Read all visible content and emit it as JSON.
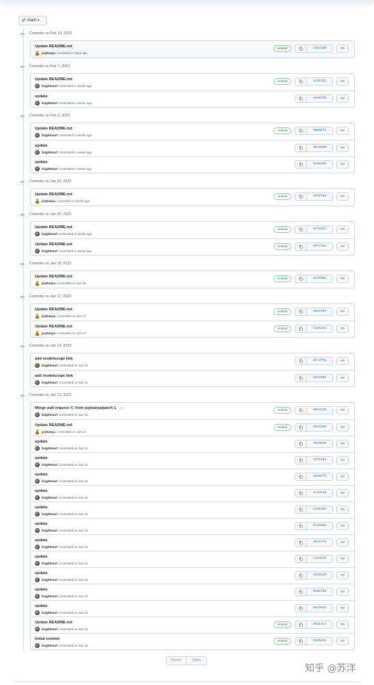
{
  "branch": {
    "label": "main",
    "icon": "git-branch-icon"
  },
  "groups": [
    {
      "date": "Commits on Feb 14, 2023",
      "commits": [
        {
          "message": "Update README.md",
          "author": "joytianya",
          "time": "committed 4 days ago",
          "verified": true,
          "sha": "c51c320"
        }
      ]
    },
    {
      "date": "Commits on Feb 7, 2023",
      "commits": [
        {
          "message": "Update README.md",
          "author": "brightmart",
          "time": "committed 2 weeks ago",
          "verified": true,
          "sha": "3c4572c"
        },
        {
          "message": "update",
          "author": "brightmart",
          "time": "committed 2 weeks ago",
          "verified": false,
          "sha": "8ee6f36"
        }
      ]
    },
    {
      "date": "Commits on Feb 3, 2023",
      "commits": [
        {
          "message": "Update README.md",
          "author": "brightmart",
          "time": "committed 2 weeks ago",
          "verified": true,
          "sha": "2906bf3"
        },
        {
          "message": "update",
          "author": "brightmart",
          "time": "committed 2 weeks ago",
          "verified": false,
          "sha": "d5c8450"
        },
        {
          "message": "update",
          "author": "brightmart",
          "time": "committed 2 weeks ago",
          "verified": false,
          "sha": "91583b0"
        }
      ]
    },
    {
      "date": "Commits on Jan 30, 2023",
      "commits": [
        {
          "message": "Update README.md",
          "author": "joytianya",
          "time": "committed 3 weeks ago",
          "verified": true,
          "sha": "4f0ff69"
        }
      ]
    },
    {
      "date": "Commits on Jan 20, 2023",
      "commits": [
        {
          "message": "Update README.md",
          "author": "brightmart",
          "time": "committed 3 weeks ago",
          "verified": true,
          "sha": "97f41f2"
        },
        {
          "message": "Update README.md",
          "author": "brightmart",
          "time": "committed 3 weeks ago",
          "verified": true,
          "sha": "b07c1a4"
        }
      ]
    },
    {
      "date": "Commits on Jan 18, 2023",
      "commits": [
        {
          "message": "Update README.md",
          "author": "joytianya",
          "time": "committed on Jan 18",
          "verified": true,
          "sha": "9c5f0ba"
        }
      ]
    },
    {
      "date": "Commits on Jan 17, 2023",
      "commits": [
        {
          "message": "Update README.md",
          "author": "joytianya",
          "time": "committed on Jan 17",
          "verified": true,
          "sha": "aaee43e"
        },
        {
          "message": "Update README.md",
          "author": "joytianya",
          "time": "committed on Jan 17",
          "verified": true,
          "sha": "b426244"
        }
      ]
    },
    {
      "date": "Commits on Jan 14, 2023",
      "commits": [
        {
          "message": "add modelscope link",
          "author": "brightmart",
          "time": "committed on Jan 14",
          "verified": false,
          "sha": "2fc7f71"
        },
        {
          "message": "add modelscope link",
          "author": "brightmart",
          "time": "committed on Jan 14",
          "verified": false,
          "sha": "5337588"
        }
      ]
    },
    {
      "date": "Commits on Jan 13, 2023",
      "commits": [
        {
          "message": "Merge pull request ",
          "link": "#1",
          "suffix": " from joytianya/patch-1",
          "author": "brightmart",
          "time": "committed on Jan 13",
          "verified": true,
          "sha": "40e3c18",
          "dots": true
        },
        {
          "message": "Update README.md",
          "author": "joytianya",
          "time": "committed on Jan 13",
          "verified": true,
          "sha": "8594260"
        },
        {
          "message": "update",
          "author": "brightmart",
          "time": "committed on Jan 13",
          "verified": false,
          "sha": "4033643"
        },
        {
          "message": "update",
          "author": "brightmart",
          "time": "committed on Jan 13",
          "verified": false,
          "sha": "2747404"
        },
        {
          "message": "update",
          "author": "brightmart",
          "time": "committed on Jan 13",
          "verified": false,
          "sha": "e630ef3"
        },
        {
          "message": "update",
          "author": "brightmart",
          "time": "committed on Jan 13",
          "verified": false,
          "sha": "1c3dca8"
        },
        {
          "message": "update",
          "author": "brightmart",
          "time": "committed on Jan 13",
          "verified": false,
          "sha": "c535380"
        },
        {
          "message": "update",
          "author": "brightmart",
          "time": "committed on Jan 13",
          "verified": false,
          "sha": "97d4686"
        },
        {
          "message": "update",
          "author": "brightmart",
          "time": "committed on Jan 13",
          "verified": false,
          "sha": "d547774"
        },
        {
          "message": "update",
          "author": "brightmart",
          "time": "committed on Jan 13",
          "verified": false,
          "sha": "3157676"
        },
        {
          "message": "update",
          "author": "brightmart",
          "time": "committed on Jan 13",
          "verified": false,
          "sha": "2649a20"
        },
        {
          "message": "update",
          "author": "brightmart",
          "time": "committed on Jan 13",
          "verified": false,
          "sha": "0301f95"
        },
        {
          "message": "update",
          "author": "brightmart",
          "time": "committed on Jan 13",
          "verified": false,
          "sha": "6a23832"
        },
        {
          "message": "Update README.md",
          "author": "brightmart",
          "time": "committed on Jan 13",
          "verified": true,
          "sha": "9eb14c4"
        },
        {
          "message": "Initial commit",
          "author": "brightmart",
          "time": "committed on Jan 13",
          "verified": true,
          "sha": "6525221"
        }
      ]
    }
  ],
  "labels": {
    "verified": "Verified",
    "browse": "<>"
  },
  "pager": {
    "newer": "Newer",
    "older": "Older"
  },
  "watermark": "知乎 @苏洋",
  "colors": {
    "link": "#0969da",
    "verified": "#1a7f37",
    "border": "#d0d7de"
  }
}
